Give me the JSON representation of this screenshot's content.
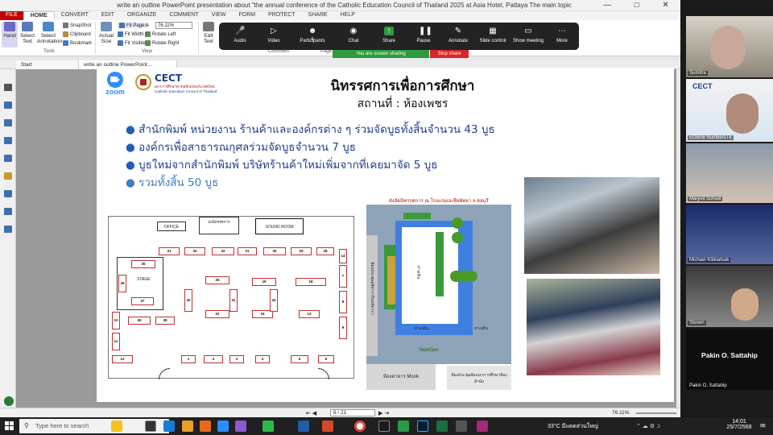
{
  "window": {
    "title": "write an outline PowerPoint presentation about \"the annual conference of the Catholic Education Council of Thailand 2025 at Asia Hotel, Pattaya The main topic"
  },
  "menu": [
    "FILE",
    "HOME",
    "CONVERT",
    "EDIT",
    "ORGANIZE",
    "COMMENT",
    "VIEW",
    "FORM",
    "PROTECT",
    "SHARE",
    "HELP"
  ],
  "ribbon": {
    "hand": "Hand",
    "select_text": "Select Text",
    "select_annotation": "Select Annotation",
    "snapshot": "SnapShot",
    "clipboard": "Clipboard",
    "bookmark": "Bookmark",
    "actual_size": "Actual Size",
    "fit_page": "Fit Page",
    "fit_width": "Fit Width",
    "fit_visible": "Fit Visible",
    "zoom_value": "76.11%",
    "rotate_left": "Rotate Left",
    "rotate_right": "Rotate Right",
    "edit_text": "Edit Text",
    "group_tools": "Tools",
    "group_view": "View",
    "group_comment": "Comment",
    "group_page": "Page"
  },
  "zoom_controls": {
    "buttons": [
      "Audio",
      "Video",
      "Participants",
      "Chat",
      "Share",
      "Pause",
      "Annotate",
      "Slide control",
      "Show meeting",
      "More"
    ],
    "participants_count": "6",
    "sharing_banner": "You are screen sharing",
    "stop_share": "Stop share"
  },
  "tabs": [
    "Start",
    "write an outline PowerPoint..."
  ],
  "slide": {
    "zoom_logo": "zoom",
    "cect_logo": "CECT",
    "cect_sub_th": "สภาการศึกษาคาทอลิกแห่งประเทศไทย",
    "cect_sub_en": "Catholic Education Council of Thailand",
    "title": "นิทรรศการเพื่อการศึกษา",
    "subtitle": "สถานที่ : ห้องเพชร",
    "bullets": [
      "สำนักพิมพ์ หน่วยงาน ร้านค้าและองค์กรต่าง ๆ ร่วมจัดบูธทั้งสิ้นจำนวน 43 บูธ",
      "องค์กรเพื่อสาธารณกุศลร่วมจัดบูธจำนวน 7 บูธ",
      "บูธใหม่จากสำนักพิมพ์ บริษัทร้านค้าใหม่เพิ่มจากที่เคยมาจัด 5 บูธ",
      "รวมทั้งสิ้น 50 บูธ"
    ],
    "floorplan": {
      "office": "OFFICE",
      "stage_sign": "ผังนิทรรศการ",
      "sound_room": "SOUND ROOM",
      "stage": "STAGE",
      "booths": [
        "31",
        "33",
        "32",
        "31",
        "30",
        "29",
        "28",
        "35",
        "36",
        "37",
        "25",
        "19",
        "18",
        "39",
        "38",
        "22",
        "16",
        "13",
        "12",
        "1",
        "2",
        "3",
        "4",
        "5",
        "6",
        "7",
        "8",
        "9",
        "10",
        "11",
        "14",
        "40",
        "41",
        "42"
      ]
    },
    "map": {
      "title": "ผังจัดนิทรรศการ ณ โรงแรมเอเชียพัทยา จ.ชลบุรี",
      "walkway_1": "ทางเดิน",
      "walkway_2": "ทางเดิน",
      "walkway_3": "ทางเดิน",
      "vertical_room": "ห้องประชุมดุสิตาวารินทร์ดารา",
      "nextgen": "NextGen",
      "mook": "ห้องอาหาร Mook",
      "room_right": "ห้องประชุมสัมมนาการศึกษาห้องสำนัก"
    }
  },
  "status": {
    "page": "6 / 21",
    "zoom": "76.11%"
  },
  "participants": [
    {
      "name": "Sumitra"
    },
    {
      "name": "EDBA6 NumbersTK"
    },
    {
      "name": "Maryvit School"
    },
    {
      "name": "Michael Kitikiatsak"
    },
    {
      "name": "Steven"
    },
    {
      "name": "Pakin O. Sattahip"
    }
  ],
  "active_speaker": "Pakin O. Sattahip",
  "taskbar": {
    "search_placeholder": "Type here to search",
    "weather": "33°C  มีแดดส่วนใหญ่",
    "time": "14:01",
    "date": "25/7/2568"
  },
  "colors": {
    "accent_red": "#c00000",
    "zoom_blue": "#2d8cff",
    "share_green": "#2d9b3e",
    "stop_red": "#d9242a",
    "bullet_green": "#3a9a3a",
    "slide_blue": "#1f5fb4"
  }
}
